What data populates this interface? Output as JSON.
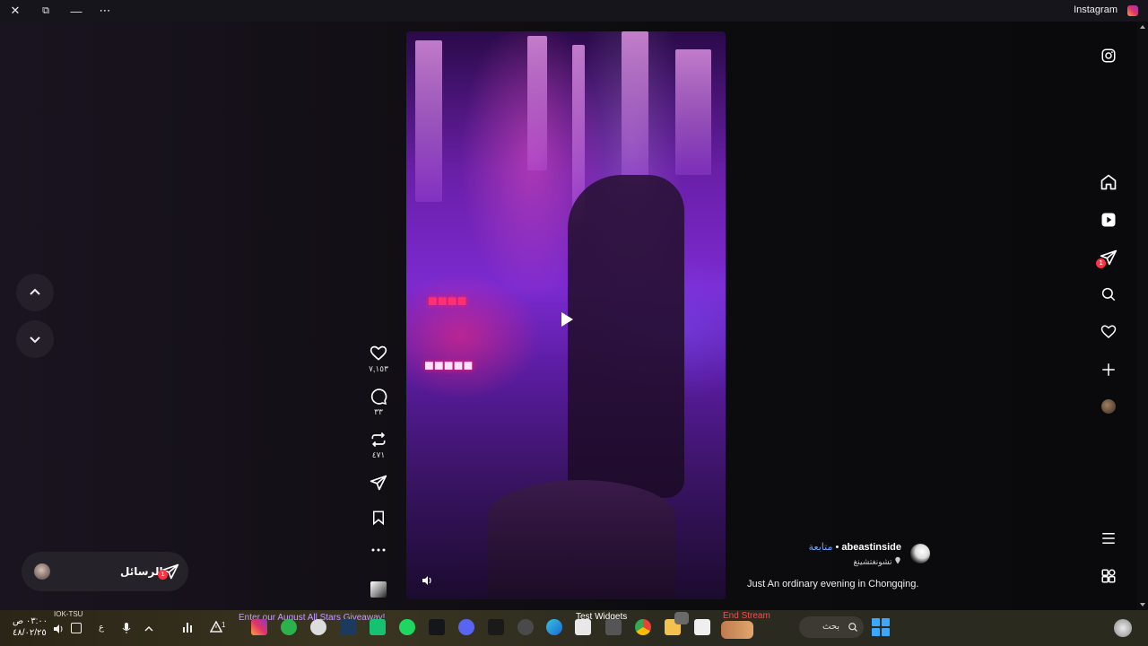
{
  "window": {
    "title": "Instagram",
    "controls": {
      "close": "✕",
      "restore": "⧉",
      "minimize": "—",
      "more": "⋯"
    }
  },
  "reel": {
    "actions": {
      "like_count": "٧,١٥٣",
      "comment_count": "٣٣",
      "repost_count": "٤٧١"
    },
    "author": {
      "username": "abeastinside",
      "separator": "•",
      "follow_label": "متابعة",
      "location": "تشونغتشينغ",
      "caption": "Just An ordinary evening in Chongqing."
    }
  },
  "right_nav": {
    "messages_badge": "1",
    "items": [
      "instagram-logo",
      "home-icon",
      "reels-icon",
      "messages-icon",
      "search-icon",
      "notifications-icon",
      "create-icon",
      "profile-avatar",
      "menu-icon",
      "apps-icon"
    ]
  },
  "messages_pill": {
    "label": "الرسائل",
    "badge": "1"
  },
  "taskbar": {
    "clock_time": "٠٣:٠٠ ص",
    "clock_date": "٤٨/٠٢/٢٥",
    "network_label": "IOK-TSU",
    "lang": "ع",
    "notice_count": "1",
    "giveaway_text": "Enter our August All Stars Giveaway!",
    "widgets_label": "Test Widgets",
    "end_stream_label": "End Stream",
    "search_label": "بحث"
  },
  "colors": {
    "accent_blue": "#6aa6ff",
    "badge_red": "#ff3040",
    "taskbar_giveaway": "#c89cff",
    "end_stream_red": "#ff4a4a"
  }
}
